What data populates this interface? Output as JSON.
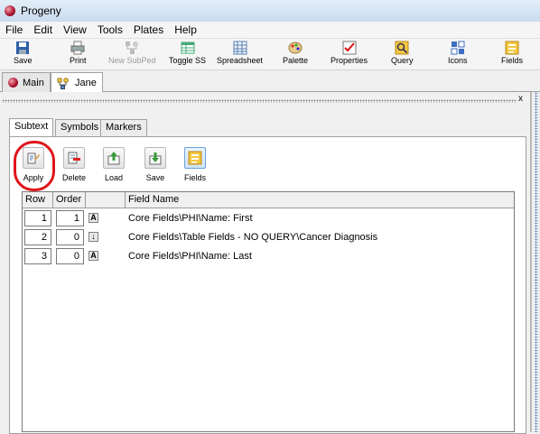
{
  "app": {
    "title": "Progeny"
  },
  "menu": [
    "File",
    "Edit",
    "View",
    "Tools",
    "Plates",
    "Help"
  ],
  "toolbar": [
    {
      "label": "Save",
      "icon": "floppy-icon",
      "enabled": true
    },
    {
      "label": "Print",
      "icon": "printer-icon",
      "enabled": true
    },
    {
      "label": "New SubPed",
      "icon": "new-subped-icon",
      "enabled": false
    },
    {
      "label": "Toggle SS",
      "icon": "toggle-spreadsheet-icon",
      "enabled": true
    },
    {
      "label": "Spreadsheet",
      "icon": "spreadsheet-icon",
      "enabled": true
    },
    {
      "label": "Palette",
      "icon": "palette-icon",
      "enabled": true
    },
    {
      "label": "Properties",
      "icon": "properties-icon",
      "enabled": true
    },
    {
      "label": "Query",
      "icon": "query-icon",
      "enabled": true
    },
    {
      "label": "Icons",
      "icon": "icons-icon",
      "enabled": true
    },
    {
      "label": "Fields",
      "icon": "fields-icon",
      "enabled": true
    }
  ],
  "doc_tabs": [
    {
      "label": "Main",
      "icon": "red-ball-icon",
      "active": false
    },
    {
      "label": "Jane",
      "icon": "pedigree-icon",
      "active": true
    }
  ],
  "panel": {
    "close_glyph": "x"
  },
  "sub_tabs": [
    {
      "label": "Subtext",
      "active": true
    },
    {
      "label": "Symbols",
      "active": false
    },
    {
      "label": "Markers",
      "active": false
    }
  ],
  "actions": [
    {
      "label": "Apply",
      "icon": "apply-icon",
      "highlighted": true
    },
    {
      "label": "Delete",
      "icon": "delete-icon",
      "highlighted": false
    },
    {
      "label": "Load",
      "icon": "load-icon",
      "highlighted": false
    },
    {
      "label": "Save",
      "icon": "save-green-icon",
      "highlighted": false
    },
    {
      "label": "Fields",
      "icon": "fields-icon",
      "highlighted": false
    }
  ],
  "grid": {
    "headers": [
      "Row",
      "Order",
      "",
      "Field Name"
    ],
    "rows": [
      {
        "row": "1",
        "order": "1",
        "type_glyph": "A",
        "field": "Core Fields\\PHI\\Name: First"
      },
      {
        "row": "2",
        "order": "0",
        "type_glyph": "↓",
        "field": "Core Fields\\Table Fields - NO QUERY\\Cancer Diagnosis"
      },
      {
        "row": "3",
        "order": "0",
        "type_glyph": "A",
        "field": "Core Fields\\PHI\\Name: Last"
      }
    ]
  }
}
